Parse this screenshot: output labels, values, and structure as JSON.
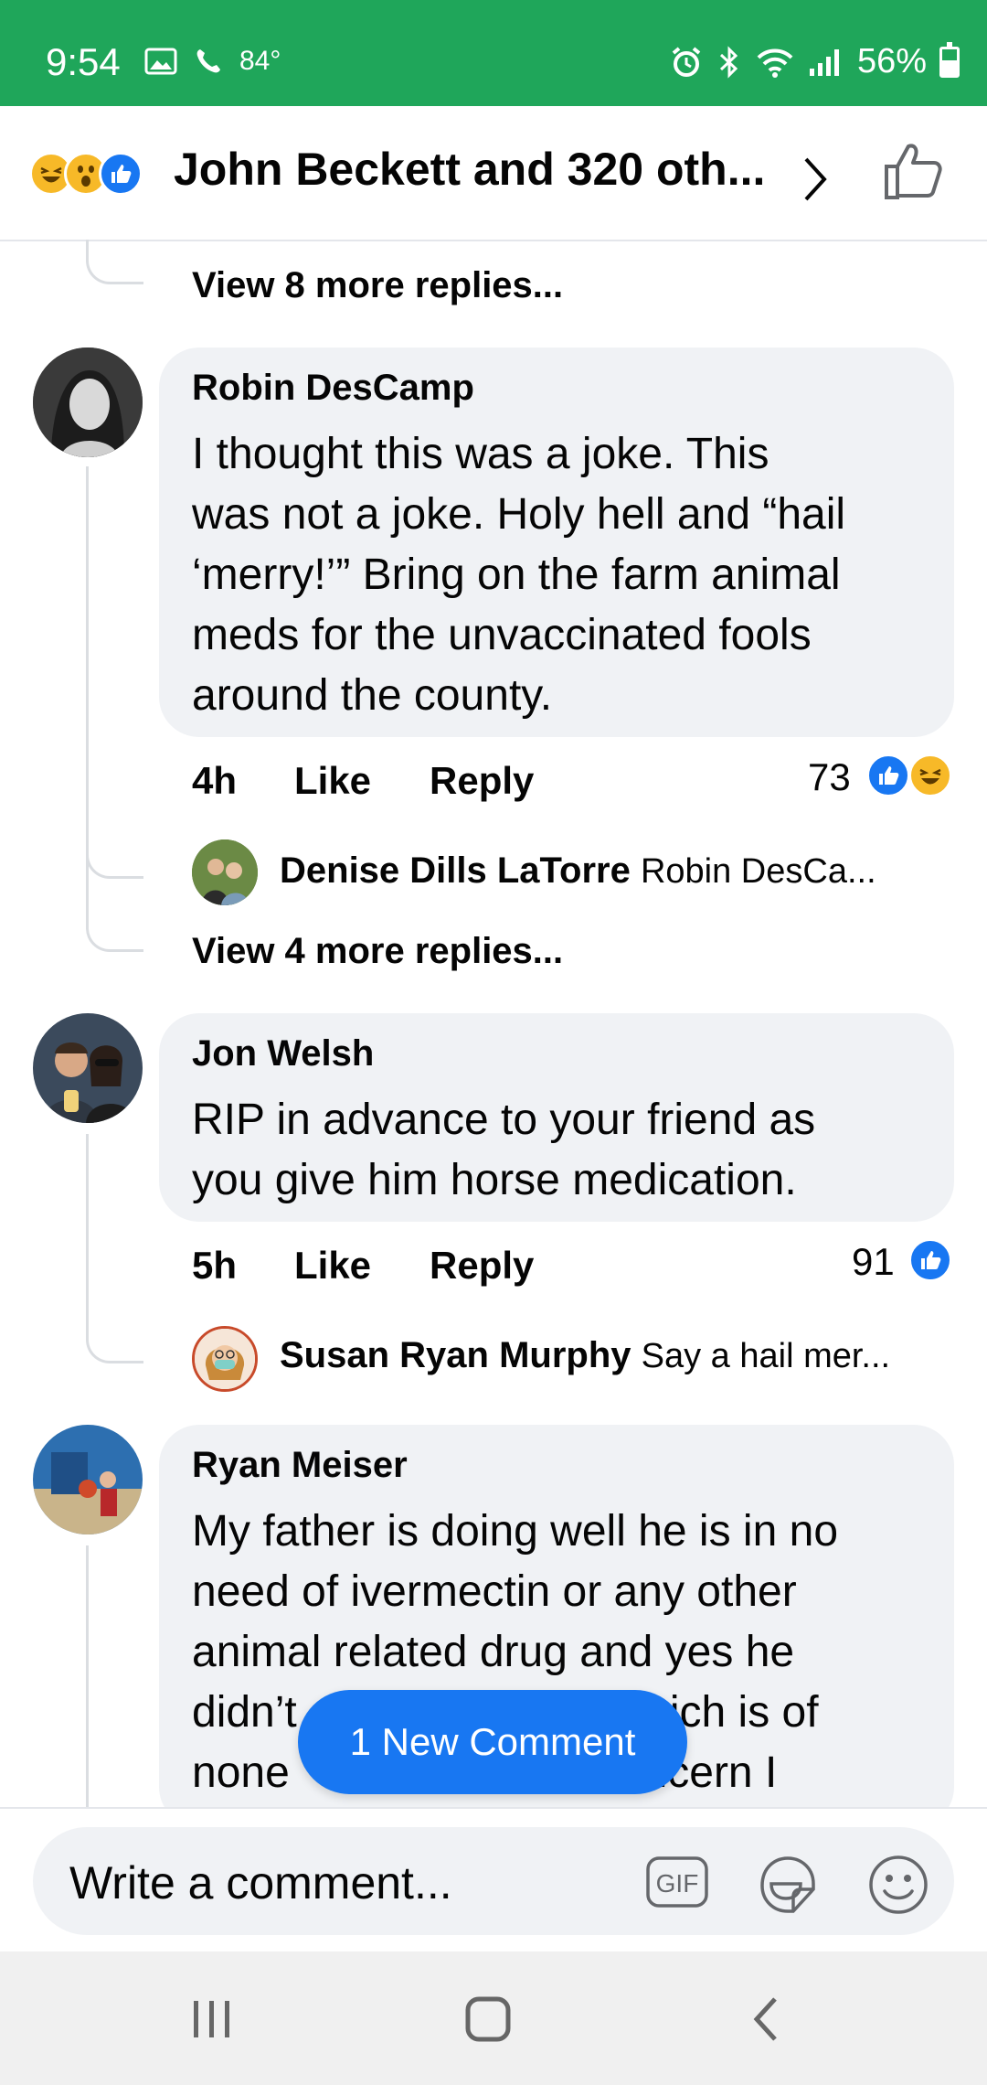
{
  "status_bar": {
    "time": "9:54",
    "temperature": "84°",
    "battery": "56%",
    "battery_level": 0.56,
    "icons": [
      "image-icon",
      "phone-icon",
      "alarm-icon",
      "bluetooth-icon",
      "wifi-icon",
      "signal-icon",
      "battery-icon"
    ]
  },
  "header": {
    "reactions": [
      "haha",
      "wow",
      "like"
    ],
    "title": "John Beckett and 320 oth...",
    "chevron": "›"
  },
  "thread": {
    "view_more_1": "View 8 more replies...",
    "view_more_2": "View 4 more replies..."
  },
  "comments": [
    {
      "author": "Robin DesCamp",
      "lines": [
        "I thought this was a joke. This",
        "was not a joke. Holy hell and “hail",
        "‘merry!’” Bring on the farm animal",
        "meds for the unvaccinated fools",
        "around the county."
      ],
      "time": "4h",
      "like": "Like",
      "reply": "Reply",
      "reaction_count": "73",
      "reactions": [
        "like",
        "haha"
      ],
      "reply_preview": {
        "author": "Denise Dills LaTorre",
        "snippet": "Robin DesCa..."
      }
    },
    {
      "author": "Jon Welsh",
      "lines": [
        "RIP in advance to your friend as",
        "you give him horse medication."
      ],
      "time": "5h",
      "like": "Like",
      "reply": "Reply",
      "reaction_count": "91",
      "reactions": [
        "like"
      ],
      "reply_preview": {
        "author": "Susan Ryan Murphy",
        "snippet": "Say a hail mer..."
      }
    },
    {
      "author": "Ryan Meiser",
      "lines": [
        "My father is doing well he is in no",
        "need of ivermectin or any other",
        "animal related drug and yes he",
        "didn’t                          which is of",
        "none                           oncern I"
      ]
    }
  ],
  "new_comment_button": "1 New Comment",
  "compose": {
    "placeholder": "Write a comment...",
    "gif_label": "GIF"
  },
  "colors": {
    "status_bar": "#1fa65a",
    "accent_blue": "#1877f2",
    "bubble_bg": "#f0f2f5",
    "reaction_yellow": "#f7b928"
  }
}
